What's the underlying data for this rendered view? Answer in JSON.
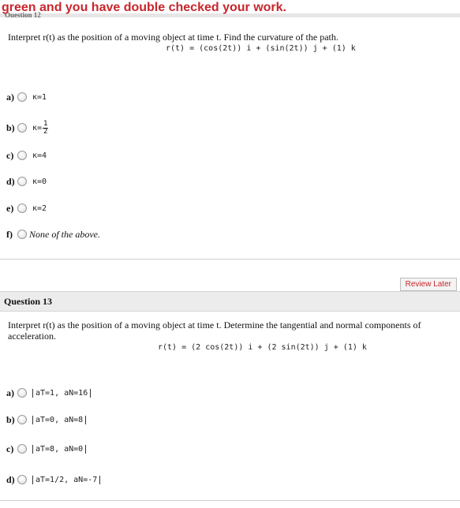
{
  "banner": {
    "text": "green and you have double checked your work.",
    "cut_label": "Question 12"
  },
  "q12": {
    "prompt": "Interpret r(t) as the position of a moving object at time t. Find the curvature of the path.",
    "formula": "r(t) = (cos(2t)) i + (sin(2t)) j + (1) k",
    "options": [
      {
        "letter": "a)",
        "value": "κ=1"
      },
      {
        "letter": "b)",
        "value_prefix": "κ=",
        "num": "1",
        "den": "2"
      },
      {
        "letter": "c)",
        "value": "κ=4"
      },
      {
        "letter": "d)",
        "value": "κ=0"
      },
      {
        "letter": "e)",
        "value": "κ=2"
      },
      {
        "letter": "f)",
        "value": "None of the above."
      }
    ]
  },
  "review_button": "Review Later",
  "q13": {
    "title": "Question 13",
    "prompt": "Interpret r(t) as the position of a moving object at time t. Determine the tangential and normal components of acceleration.",
    "formula": "r(t) = (2 cos(2t)) i + (2 sin(2t)) j + (1) k",
    "options": [
      {
        "letter": "a)",
        "value": "aT=1, aN=16"
      },
      {
        "letter": "b)",
        "value": "aT=0, aN=8"
      },
      {
        "letter": "c)",
        "value": "aT=8, aN=0"
      },
      {
        "letter": "d)",
        "value": "aT=1/2, aN=-7"
      }
    ]
  }
}
